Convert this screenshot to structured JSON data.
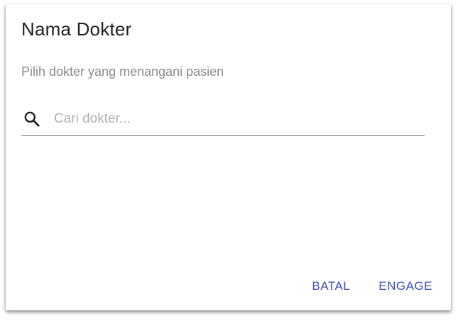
{
  "dialog": {
    "title": "Nama Dokter",
    "subtitle": "Pilih dokter yang menangani pasien",
    "search": {
      "icon": "search-icon",
      "placeholder": "Cari dokter...",
      "value": ""
    },
    "actions": {
      "cancel_label": "BATAL",
      "confirm_label": "ENGAGE"
    }
  },
  "colors": {
    "accent": "#3f51b5",
    "title_text": "#212121",
    "subtitle_text": "#8a8a8a",
    "placeholder_text": "#b0b0b0",
    "underline": "#8e8e8e"
  }
}
